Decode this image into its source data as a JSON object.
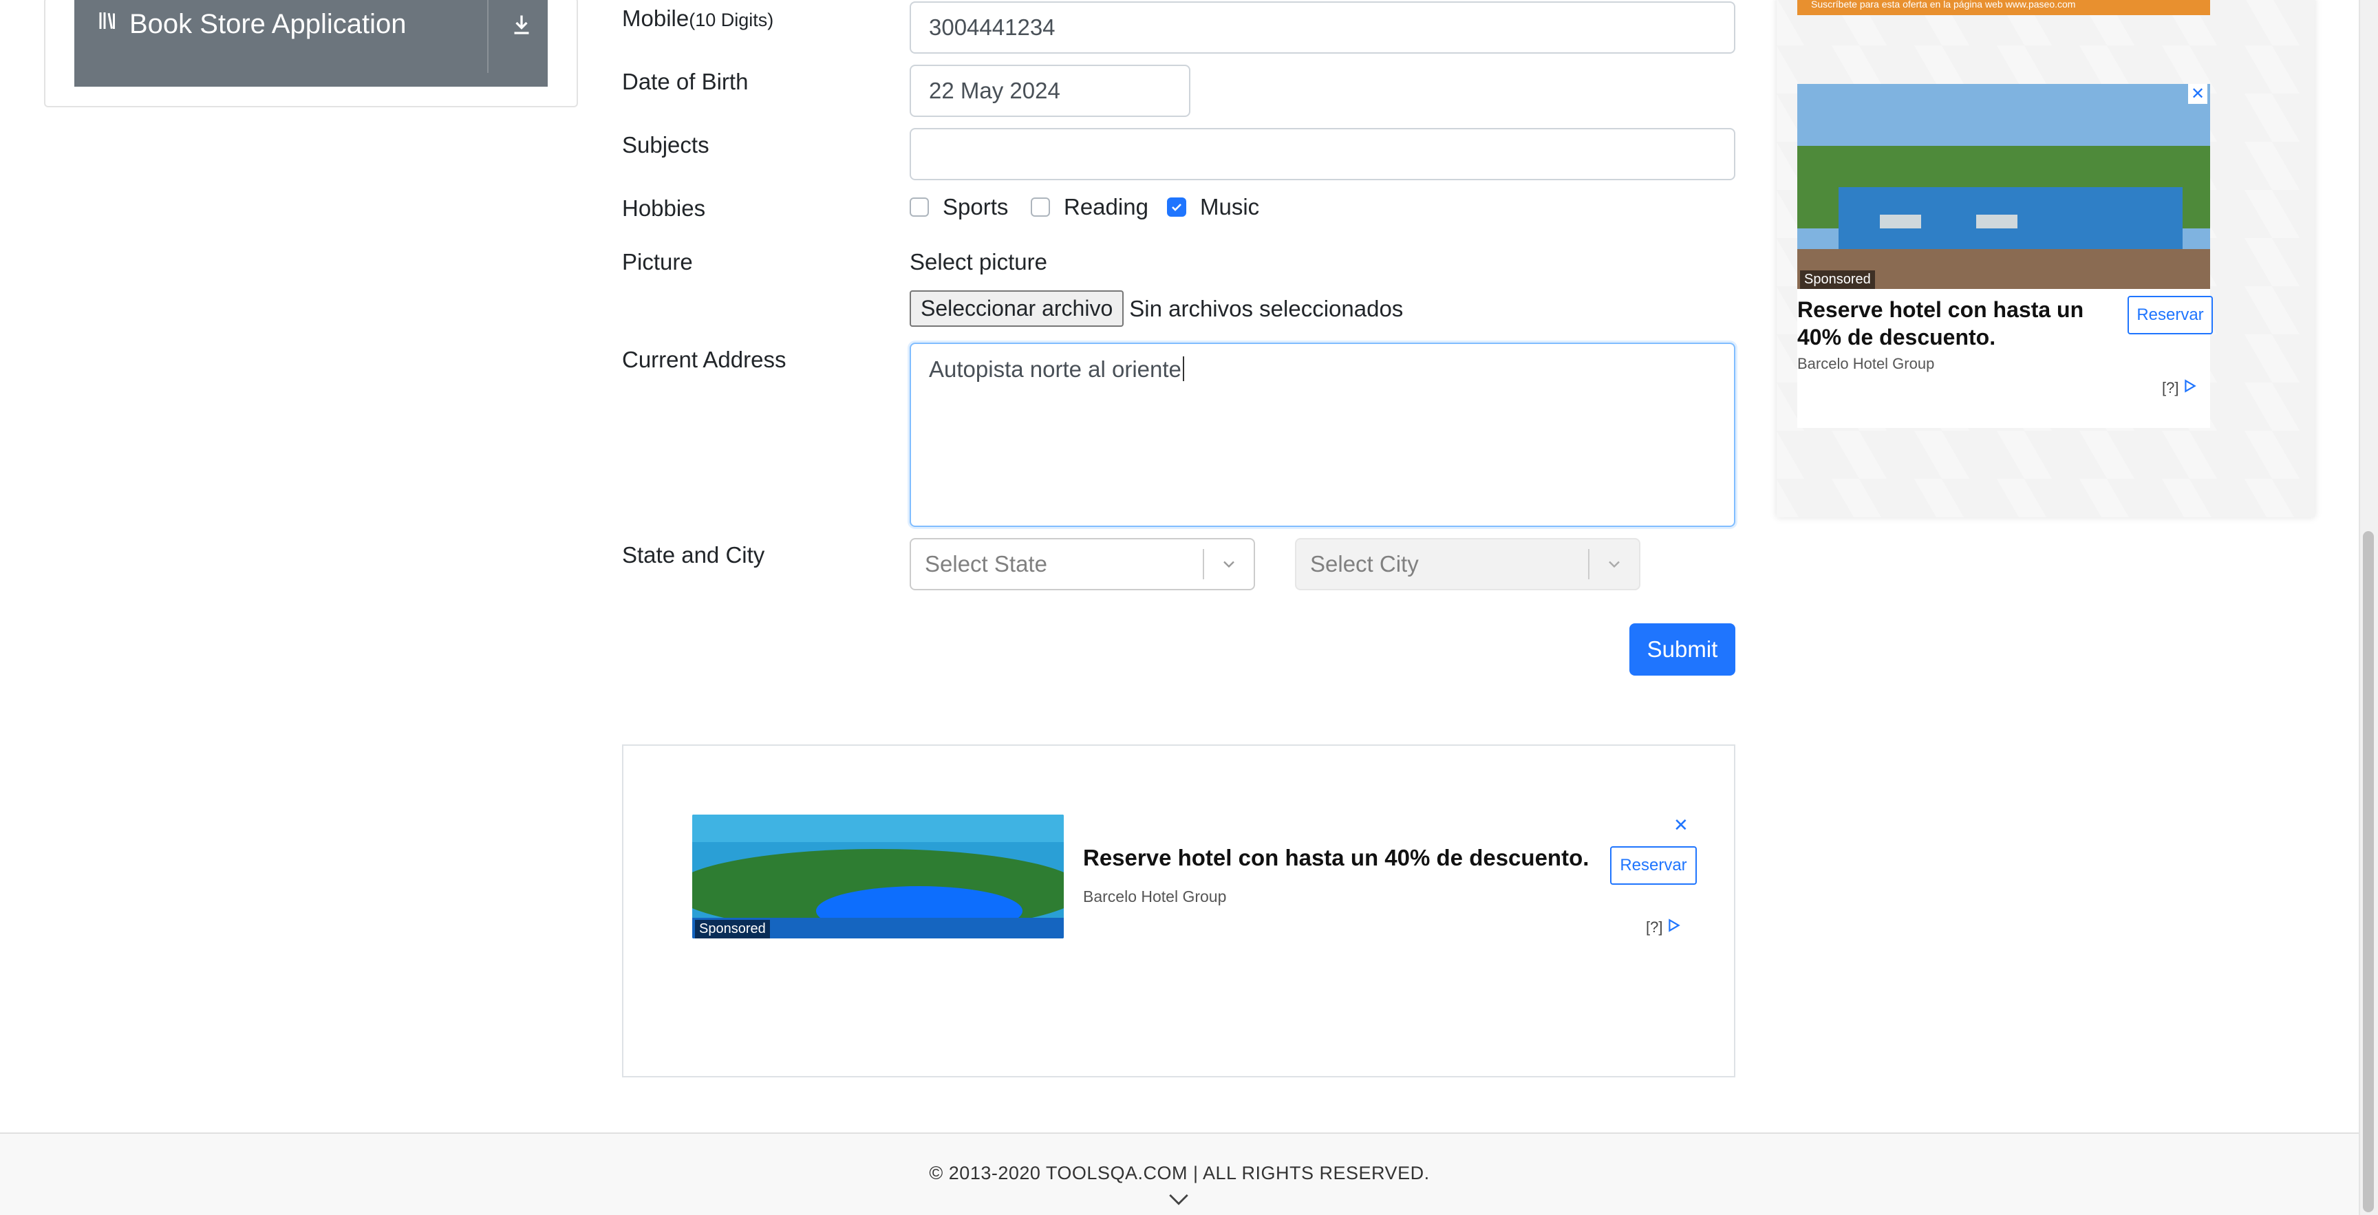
{
  "sidebar": {
    "group_label": "Book Store Application"
  },
  "form": {
    "mobile": {
      "label": "Mobile",
      "hint": "(10 Digits)",
      "value": "3004441234"
    },
    "dob": {
      "label": "Date of Birth",
      "value": "22 May 2024"
    },
    "subjects": {
      "label": "Subjects",
      "value": ""
    },
    "hobbies": {
      "label": "Hobbies",
      "options": [
        {
          "label": "Sports",
          "checked": false
        },
        {
          "label": "Reading",
          "checked": false
        },
        {
          "label": "Music",
          "checked": true
        }
      ]
    },
    "picture": {
      "label": "Picture",
      "prompt": "Select picture",
      "button": "Seleccionar archivo",
      "status": "Sin archivos seleccionados"
    },
    "address": {
      "label": "Current Address",
      "value": "Autopista norte al oriente"
    },
    "state_city": {
      "label": "State and City",
      "state_placeholder": "Select State",
      "city_placeholder": "Select City"
    },
    "submit_label": "Submit"
  },
  "bottom_ad": {
    "headline": "Reserve hotel con hasta un 40% de descuento.",
    "advertiser": "Barcelo Hotel Group",
    "button": "Reservar",
    "sponsored": "Sponsored",
    "help": "[?]",
    "close": "✕"
  },
  "right_ad": {
    "headline": "Reserve hotel con hasta un 40% de descuento.",
    "advertiser": "Barcelo Hotel Group",
    "button": "Reservar",
    "sponsored": "Sponsored",
    "help": "[?]",
    "close": "✕",
    "top_strip_text": "Suscríbete para esta oferta en la página web www.paseo.com"
  },
  "footer": {
    "copyright": "© 2013-2020 TOOLSQA.COM | ALL RIGHTS RESERVED."
  },
  "colors": {
    "accent": "#1f75fe",
    "sidebar_group": "#6c757d",
    "footer_bg": "#f8f8f8"
  }
}
